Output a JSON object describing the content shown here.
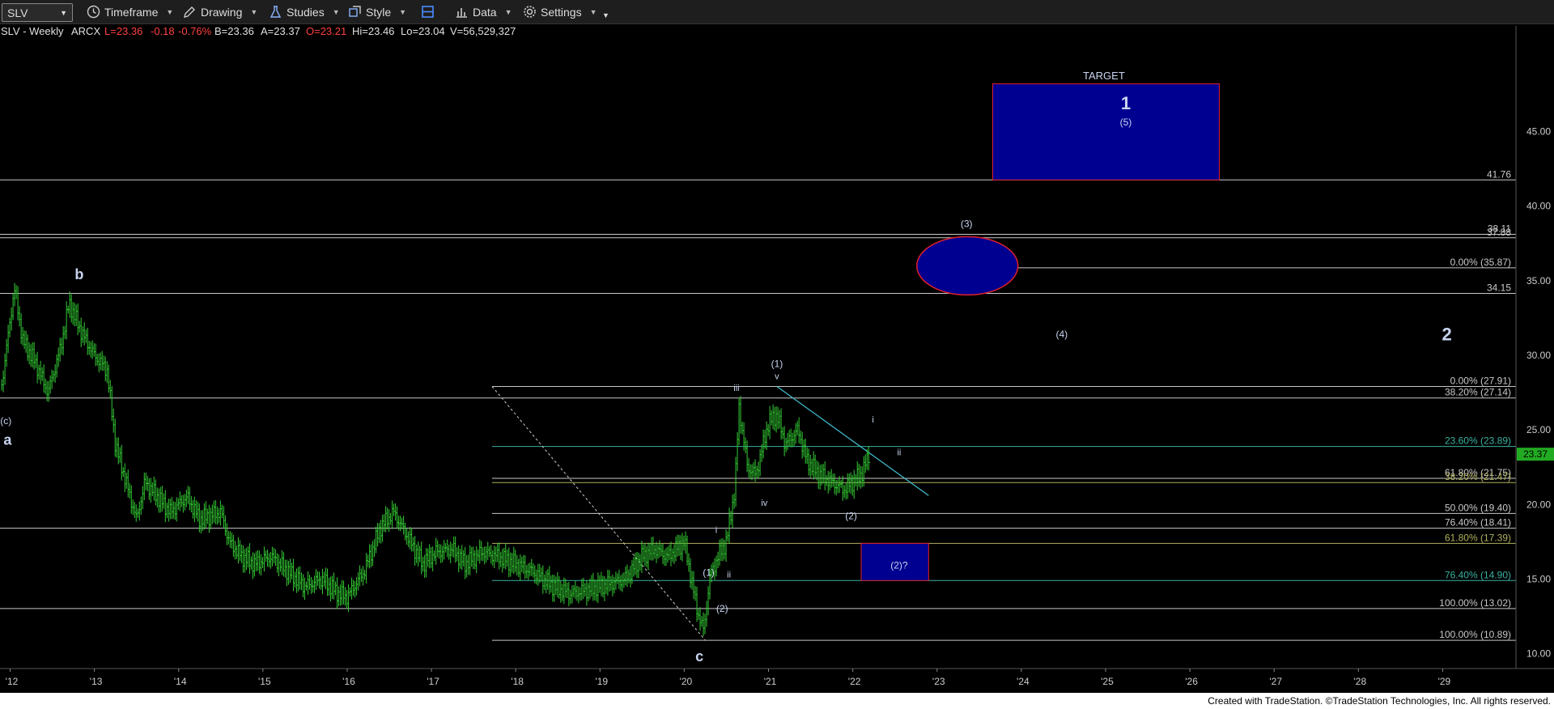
{
  "toolbar": {
    "symbol": "SLV",
    "timeframe_label": "Timeframe",
    "drawing_label": "Drawing",
    "studies_label": "Studies",
    "style_label": "Style",
    "data_label": "Data",
    "settings_label": "Settings"
  },
  "header": {
    "name": "SLV - Weekly",
    "exchange": "ARCX",
    "last": "L=23.36",
    "change": "-0.18",
    "change_pct": "-0.76%",
    "bid": "B=23.36",
    "ask": "A=23.37",
    "open": "O=23.21",
    "high": "Hi=23.46",
    "low": "Lo=23.04",
    "volume": "V=56,529,327"
  },
  "footer": {
    "text": "Created with TradeStation. ©TradeStation Technologies, Inc. All rights reserved."
  },
  "colors": {
    "price": "#33cc33",
    "level": "#c8c8c8",
    "fib": "#3ab0a0",
    "box": "#000090",
    "box_border": "#e0202a",
    "trend": "#40c0d0"
  },
  "chart_data": {
    "type": "line",
    "ylim": [
      9,
      51
    ],
    "ytick_values": [
      10,
      15,
      20,
      25,
      30,
      35,
      40,
      45
    ],
    "y_ticks": [
      "10.00",
      "15.00",
      "20.00",
      "25.00",
      "30.00",
      "35.00",
      "40.00",
      "45.00"
    ],
    "x_ticks": [
      "'12",
      "'13",
      "'14",
      "'15",
      "'16",
      "'17",
      "'18",
      "'19",
      "'20",
      "'21",
      "'22",
      "'23",
      "'24",
      "'25",
      "'26",
      "'27",
      "'28",
      "'29"
    ],
    "x_tick_years": [
      2012,
      2013,
      2014,
      2015,
      2016,
      2017,
      2018,
      2019,
      2020,
      2021,
      2022,
      2023,
      2024,
      2025,
      2026,
      2027,
      2028,
      2029
    ],
    "xlim": [
      2011.88,
      2029.87
    ],
    "last_price": "23.37",
    "series": [
      {
        "x": [
          2011.9,
          2012.05,
          2012.15,
          2012.3,
          2012.45,
          2012.6,
          2012.7,
          2012.85,
          2013.0,
          2013.15,
          2013.25,
          2013.35,
          2013.5,
          2013.6,
          2013.75,
          2013.9,
          2014.1,
          2014.25,
          2014.5,
          2014.6,
          2014.75,
          2014.9,
          2015.1,
          2015.3,
          2015.5,
          2015.7,
          2015.9,
          2016.0,
          2016.2,
          2016.4,
          2016.55,
          2016.75,
          2016.9,
          2017.05,
          2017.25,
          2017.4,
          2017.6,
          2017.8,
          2018.0,
          2018.2,
          2018.45,
          2018.65,
          2018.8,
          2019.0,
          2019.3,
          2019.5,
          2019.65,
          2019.8,
          2020.0,
          2020.15,
          2020.23,
          2020.3,
          2020.4,
          2020.5,
          2020.6,
          2020.65,
          2020.75,
          2020.85,
          2021.0,
          2021.1,
          2021.2,
          2021.35,
          2021.45,
          2021.6,
          2021.75,
          2021.9,
          2022.0,
          2022.1,
          2022.2
        ],
        "y": [
          28.0,
          34.5,
          31.0,
          29.5,
          27.5,
          30.5,
          33.5,
          31.5,
          30.0,
          29.0,
          24.0,
          22.0,
          19.0,
          21.5,
          20.5,
          19.5,
          20.5,
          19.0,
          19.5,
          17.5,
          16.5,
          16.0,
          16.5,
          15.5,
          14.5,
          15.0,
          14.0,
          13.8,
          15.5,
          18.5,
          19.5,
          17.5,
          16.0,
          16.8,
          17.0,
          16.0,
          16.8,
          16.5,
          16.0,
          15.5,
          14.5,
          14.0,
          14.2,
          14.5,
          15.0,
          16.5,
          17.0,
          16.5,
          17.5,
          13.0,
          11.5,
          15.0,
          16.5,
          17.5,
          21.0,
          26.5,
          22.5,
          22.0,
          25.5,
          26.0,
          24.0,
          25.0,
          23.0,
          22.0,
          21.5,
          21.0,
          21.5,
          22.0,
          23.4
        ]
      }
    ],
    "horizontal_levels": [
      {
        "value": 41.76,
        "label": "41.76"
      },
      {
        "value": 38.11,
        "label": "38.11"
      },
      {
        "value": 37.88,
        "label": "37.88"
      },
      {
        "value": 35.87,
        "label": "0.00% (35.87)"
      },
      {
        "value": 34.15,
        "label": "34.15"
      },
      {
        "value": 27.91,
        "label": "0.00% (27.91)"
      },
      {
        "value": 27.14,
        "label": "38.20% (27.14)"
      },
      {
        "value": 23.89,
        "label": "23.60% (23.89)"
      },
      {
        "value": 21.75,
        "label": "61.80% (21.75)"
      },
      {
        "value": 21.47,
        "label": "38.20% (21.47)"
      },
      {
        "value": 19.4,
        "label": "50.00% (19.40)"
      },
      {
        "value": 18.41,
        "label": "76.40% (18.41)"
      },
      {
        "value": 17.39,
        "label": "61.80% (17.39)"
      },
      {
        "value": 14.9,
        "label": "76.40% (14.90)"
      },
      {
        "value": 13.02,
        "label": "100.00% (13.02)"
      },
      {
        "value": 10.89,
        "label": "100.00% (10.89)"
      }
    ],
    "annotations": [
      {
        "text": "b",
        "x": 2012.82,
        "y": 35.1,
        "size": 18,
        "bold": true
      },
      {
        "text": "(c)",
        "x": 2011.95,
        "y": 25.4,
        "size": 12
      },
      {
        "text": "a",
        "x": 2011.97,
        "y": 24.0,
        "size": 18,
        "bold": true
      },
      {
        "text": "c",
        "x": 2020.18,
        "y": 9.5,
        "size": 18,
        "bold": true
      },
      {
        "text": "TARGET",
        "x": 2024.98,
        "y": 48.5,
        "size": 13
      },
      {
        "text": "1",
        "x": 2025.24,
        "y": 46.5,
        "size": 22,
        "bold": true
      },
      {
        "text": "(5)",
        "x": 2025.24,
        "y": 45.4,
        "size": 12
      },
      {
        "text": "(3)",
        "x": 2023.35,
        "y": 38.6,
        "size": 12
      },
      {
        "text": "(4)",
        "x": 2024.48,
        "y": 31.2,
        "size": 12
      },
      {
        "text": "2",
        "x": 2029.05,
        "y": 31.0,
        "size": 22,
        "bold": true
      },
      {
        "text": "(1)",
        "x": 2021.1,
        "y": 29.2,
        "size": 12
      },
      {
        "text": "v",
        "x": 2021.1,
        "y": 28.4,
        "size": 11
      },
      {
        "text": "iii",
        "x": 2020.62,
        "y": 27.6,
        "size": 11
      },
      {
        "text": "i",
        "x": 2022.24,
        "y": 25.5,
        "size": 11
      },
      {
        "text": "ii",
        "x": 2022.55,
        "y": 23.3,
        "size": 11
      },
      {
        "text": "iv",
        "x": 2020.95,
        "y": 19.9,
        "size": 11
      },
      {
        "text": "(2)",
        "x": 2021.98,
        "y": 19.0,
        "size": 12
      },
      {
        "text": "i",
        "x": 2020.38,
        "y": 18.1,
        "size": 11
      },
      {
        "text": "(1)",
        "x": 2020.29,
        "y": 15.2,
        "size": 12
      },
      {
        "text": "ii",
        "x": 2020.53,
        "y": 15.1,
        "size": 11
      },
      {
        "text": "(2)",
        "x": 2020.45,
        "y": 12.8,
        "size": 12
      },
      {
        "text": "(2)?",
        "x": 2022.55,
        "y": 15.7,
        "size": 12
      }
    ],
    "target_box": {
      "x0": 2023.66,
      "x1": 2026.35,
      "y0": 41.76,
      "y1": 48.2
    },
    "ellipse": {
      "cx": 2023.36,
      "cy": 36.0,
      "rx": 0.6,
      "ry": 1.95
    },
    "wave2_box": {
      "x0": 2022.1,
      "x1": 2022.9,
      "y0": 14.9,
      "y1": 17.39
    },
    "trendline": {
      "x0": 2021.1,
      "y0": 27.91,
      "x1": 2022.9,
      "y1": 20.6
    },
    "dashed_line": {
      "x0": 2017.72,
      "y0": 27.91,
      "x1": 2020.25,
      "y1": 10.89
    }
  }
}
